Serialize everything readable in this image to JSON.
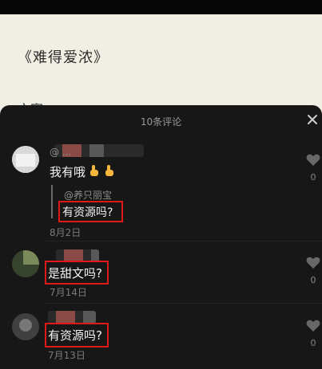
{
  "article": {
    "title": "《难得爱浓》",
    "next_line": "文案"
  },
  "comments_sheet": {
    "header": "10条评论"
  },
  "comments": [
    {
      "nickname": "@ ...",
      "text": "我有哦",
      "likes": "0",
      "reply_user": "@养只丽宝",
      "reply_text": "有资源吗?",
      "date": "8月2日"
    },
    {
      "text": "是甜文吗?",
      "likes": "0",
      "date": "7月14日"
    },
    {
      "text": "有资源吗?",
      "likes": "0",
      "date": "7月13日"
    }
  ],
  "icons": {
    "close": "close-icon",
    "like": "heart-icon",
    "emoji": "pointing-down-hand-icon"
  },
  "colors": {
    "highlight": "#e01818",
    "sheet": "#171717",
    "article_bg": "#f1eee3"
  }
}
